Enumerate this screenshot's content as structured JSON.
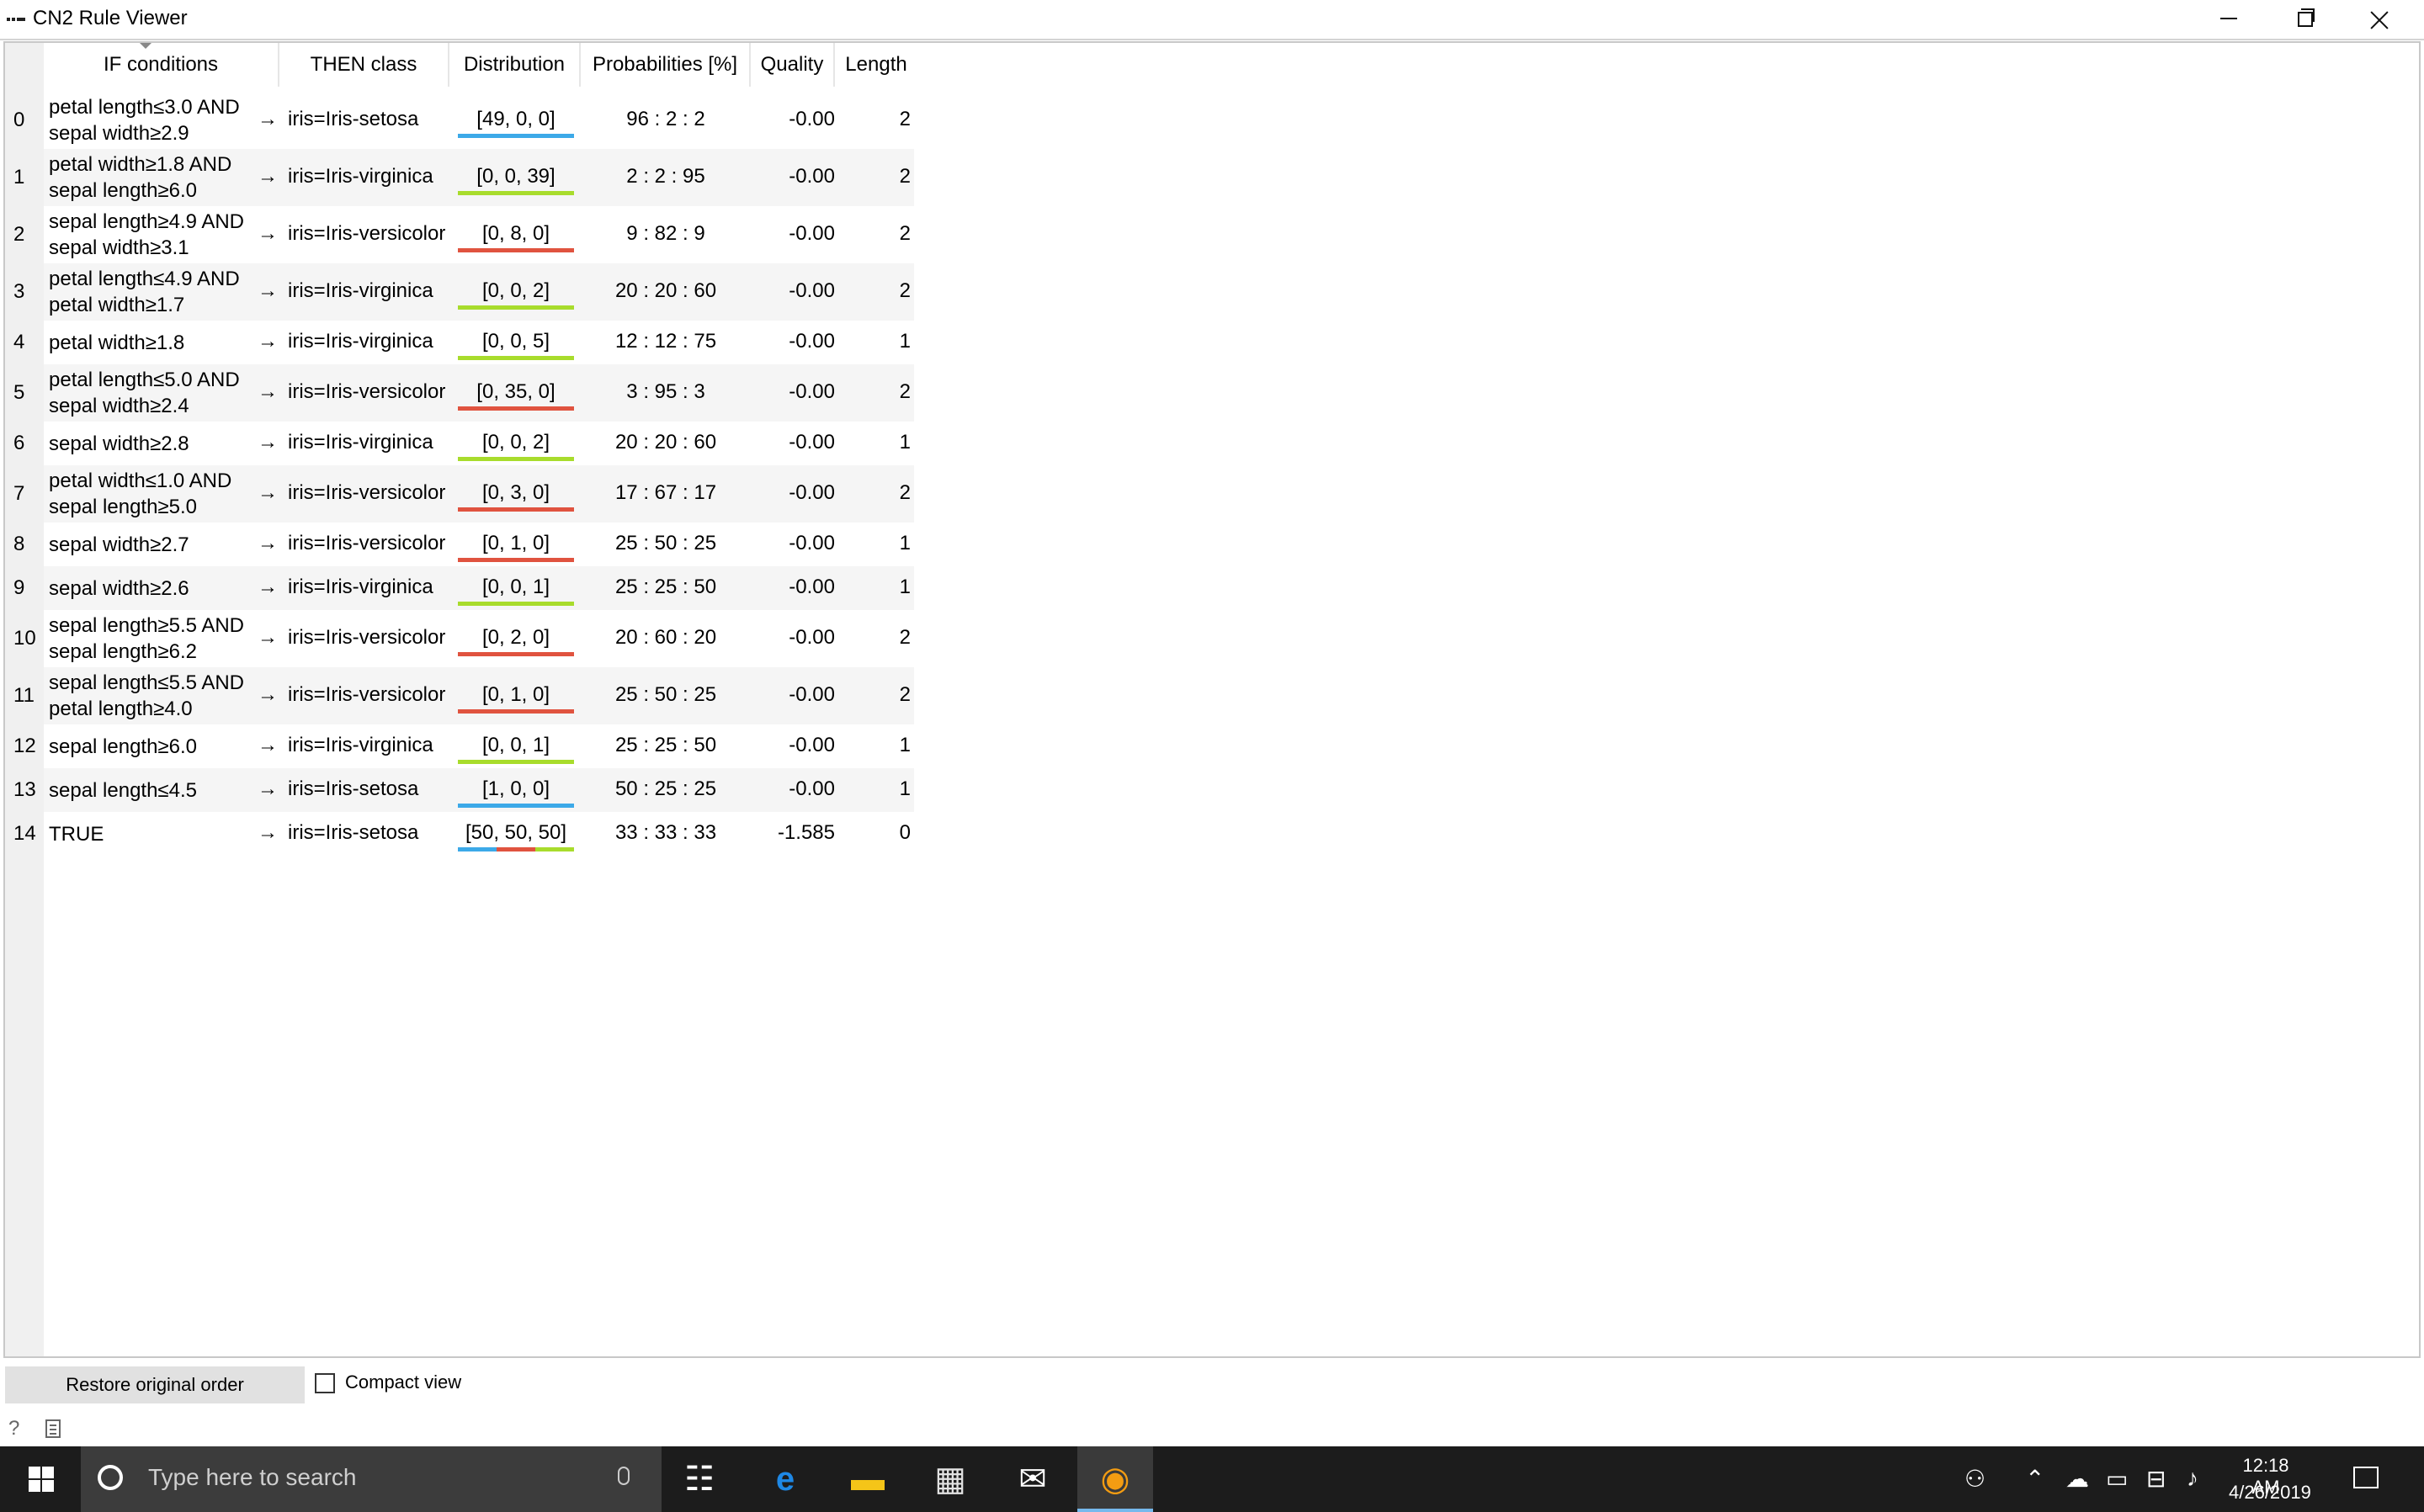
{
  "window": {
    "title": "CN2 Rule Viewer"
  },
  "table": {
    "headers": [
      "IF conditions",
      "THEN class",
      "Distribution",
      "Probabilities [%]",
      "Quality",
      "Length"
    ],
    "rows": [
      {
        "index": "0",
        "conditions": [
          "petal length≤3.0 AND",
          "sepal width≥2.9"
        ],
        "arrow": "→",
        "class": "iris=Iris-setosa",
        "distribution": "[49, 0, 0]",
        "dist_counts": [
          49,
          0,
          0
        ],
        "probabilities": "96 : 2 : 2",
        "quality": "-0.00",
        "length": "2"
      },
      {
        "index": "1",
        "conditions": [
          "petal width≥1.8 AND",
          "sepal length≥6.0"
        ],
        "arrow": "→",
        "class": "iris=Iris-virginica",
        "distribution": "[0, 0, 39]",
        "dist_counts": [
          0,
          0,
          39
        ],
        "probabilities": "2 : 2 : 95",
        "quality": "-0.00",
        "length": "2"
      },
      {
        "index": "2",
        "conditions": [
          "sepal length≥4.9 AND",
          "sepal width≥3.1"
        ],
        "arrow": "→",
        "class": "iris=Iris-versicolor",
        "distribution": "[0, 8, 0]",
        "dist_counts": [
          0,
          8,
          0
        ],
        "probabilities": "9 : 82 : 9",
        "quality": "-0.00",
        "length": "2"
      },
      {
        "index": "3",
        "conditions": [
          "petal length≤4.9 AND",
          "petal width≥1.7"
        ],
        "arrow": "→",
        "class": "iris=Iris-virginica",
        "distribution": "[0, 0, 2]",
        "dist_counts": [
          0,
          0,
          2
        ],
        "probabilities": "20 : 20 : 60",
        "quality": "-0.00",
        "length": "2"
      },
      {
        "index": "4",
        "conditions": [
          "petal width≥1.8"
        ],
        "arrow": "→",
        "class": "iris=Iris-virginica",
        "distribution": "[0, 0, 5]",
        "dist_counts": [
          0,
          0,
          5
        ],
        "probabilities": "12 : 12 : 75",
        "quality": "-0.00",
        "length": "1"
      },
      {
        "index": "5",
        "conditions": [
          "petal length≤5.0 AND",
          "sepal width≥2.4"
        ],
        "arrow": "→",
        "class": "iris=Iris-versicolor",
        "distribution": "[0, 35, 0]",
        "dist_counts": [
          0,
          35,
          0
        ],
        "probabilities": "3 : 95 : 3",
        "quality": "-0.00",
        "length": "2"
      },
      {
        "index": "6",
        "conditions": [
          "sepal width≥2.8"
        ],
        "arrow": "→",
        "class": "iris=Iris-virginica",
        "distribution": "[0, 0, 2]",
        "dist_counts": [
          0,
          0,
          2
        ],
        "probabilities": "20 : 20 : 60",
        "quality": "-0.00",
        "length": "1"
      },
      {
        "index": "7",
        "conditions": [
          "petal width≤1.0 AND",
          "sepal length≥5.0"
        ],
        "arrow": "→",
        "class": "iris=Iris-versicolor",
        "distribution": "[0, 3, 0]",
        "dist_counts": [
          0,
          3,
          0
        ],
        "probabilities": "17 : 67 : 17",
        "quality": "-0.00",
        "length": "2"
      },
      {
        "index": "8",
        "conditions": [
          "sepal width≥2.7"
        ],
        "arrow": "→",
        "class": "iris=Iris-versicolor",
        "distribution": "[0, 1, 0]",
        "dist_counts": [
          0,
          1,
          0
        ],
        "probabilities": "25 : 50 : 25",
        "quality": "-0.00",
        "length": "1"
      },
      {
        "index": "9",
        "conditions": [
          "sepal width≥2.6"
        ],
        "arrow": "→",
        "class": "iris=Iris-virginica",
        "distribution": "[0, 0, 1]",
        "dist_counts": [
          0,
          0,
          1
        ],
        "probabilities": "25 : 25 : 50",
        "quality": "-0.00",
        "length": "1"
      },
      {
        "index": "10",
        "conditions": [
          "sepal length≥5.5 AND",
          "sepal length≥6.2"
        ],
        "arrow": "→",
        "class": "iris=Iris-versicolor",
        "distribution": "[0, 2, 0]",
        "dist_counts": [
          0,
          2,
          0
        ],
        "probabilities": "20 : 60 : 20",
        "quality": "-0.00",
        "length": "2"
      },
      {
        "index": "11",
        "conditions": [
          "sepal length≤5.5 AND",
          "petal length≥4.0"
        ],
        "arrow": "→",
        "class": "iris=Iris-versicolor",
        "distribution": "[0, 1, 0]",
        "dist_counts": [
          0,
          1,
          0
        ],
        "probabilities": "25 : 50 : 25",
        "quality": "-0.00",
        "length": "2"
      },
      {
        "index": "12",
        "conditions": [
          "sepal length≥6.0"
        ],
        "arrow": "→",
        "class": "iris=Iris-virginica",
        "distribution": "[0, 0, 1]",
        "dist_counts": [
          0,
          0,
          1
        ],
        "probabilities": "25 : 25 : 50",
        "quality": "-0.00",
        "length": "1"
      },
      {
        "index": "13",
        "conditions": [
          "sepal length≤4.5"
        ],
        "arrow": "→",
        "class": "iris=Iris-setosa",
        "distribution": "[1, 0, 0]",
        "dist_counts": [
          1,
          0,
          0
        ],
        "probabilities": "50 : 25 : 25",
        "quality": "-0.00",
        "length": "1"
      },
      {
        "index": "14",
        "conditions": [
          "TRUE"
        ],
        "arrow": "→",
        "class": "iris=Iris-setosa",
        "distribution": "[50, 50, 50]",
        "dist_counts": [
          50,
          50,
          50
        ],
        "probabilities": "33 : 33 : 33",
        "quality": "-1.585",
        "length": "0"
      }
    ],
    "class_colors": [
      "#3ca9e8",
      "#e0533f",
      "#a8dc2c"
    ]
  },
  "controls": {
    "restore_label": "Restore original order",
    "compact_label": "Compact view",
    "compact_checked": false
  },
  "status_icons": [
    "help-icon",
    "report-icon"
  ],
  "taskbar": {
    "search_placeholder": "Type here to search",
    "apps": [
      "task-view-icon",
      "edge-icon",
      "file-explorer-icon",
      "store-icon",
      "mail-icon",
      "orange-app-icon"
    ],
    "clock_time": "12:18 AM",
    "clock_date": "4/26/2019"
  }
}
